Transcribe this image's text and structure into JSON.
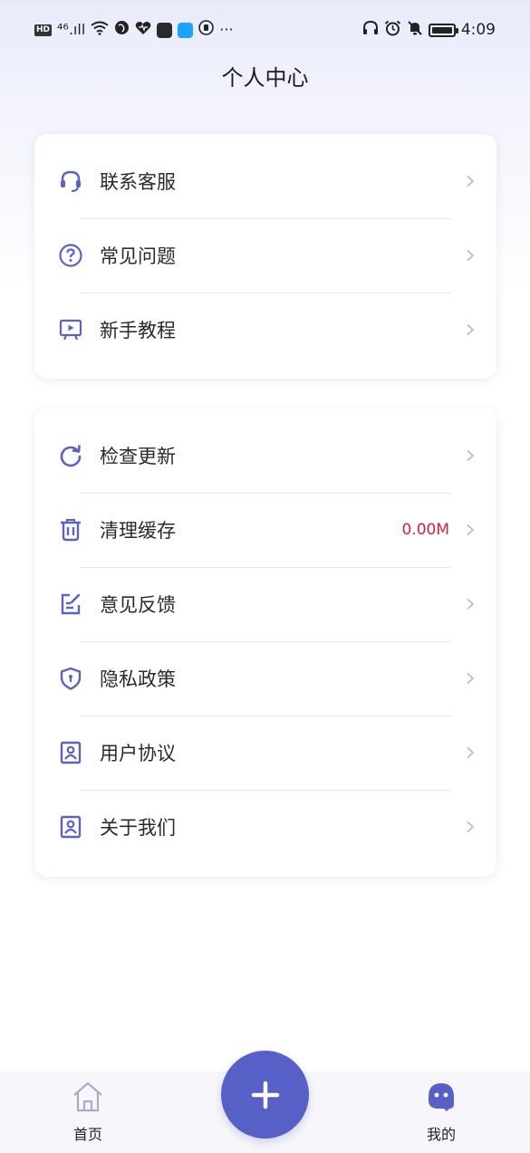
{
  "status_bar": {
    "left_badge": "HD",
    "signal": "⁴⁶.ıll",
    "more": "···",
    "time": "4:09"
  },
  "header": {
    "title": "个人中心"
  },
  "group1": [
    {
      "label": "联系客服",
      "icon": "headset-icon"
    },
    {
      "label": "常见问题",
      "icon": "question-icon"
    },
    {
      "label": "新手教程",
      "icon": "video-tutorial-icon"
    }
  ],
  "group2": [
    {
      "label": "检查更新",
      "icon": "refresh-icon"
    },
    {
      "label": "清理缓存",
      "icon": "trash-icon",
      "value": "0.00M"
    },
    {
      "label": "意见反馈",
      "icon": "feedback-edit-icon"
    },
    {
      "label": "隐私政策",
      "icon": "shield-icon"
    },
    {
      "label": "用户协议",
      "icon": "user-doc-icon"
    },
    {
      "label": "关于我们",
      "icon": "user-doc-icon"
    }
  ],
  "tabbar": {
    "home": "首页",
    "mine": "我的",
    "fab_icon": "plus-icon"
  },
  "colors": {
    "accent": "#5660c7",
    "icon": "#5b62c4",
    "value_red": "#d0263a"
  }
}
